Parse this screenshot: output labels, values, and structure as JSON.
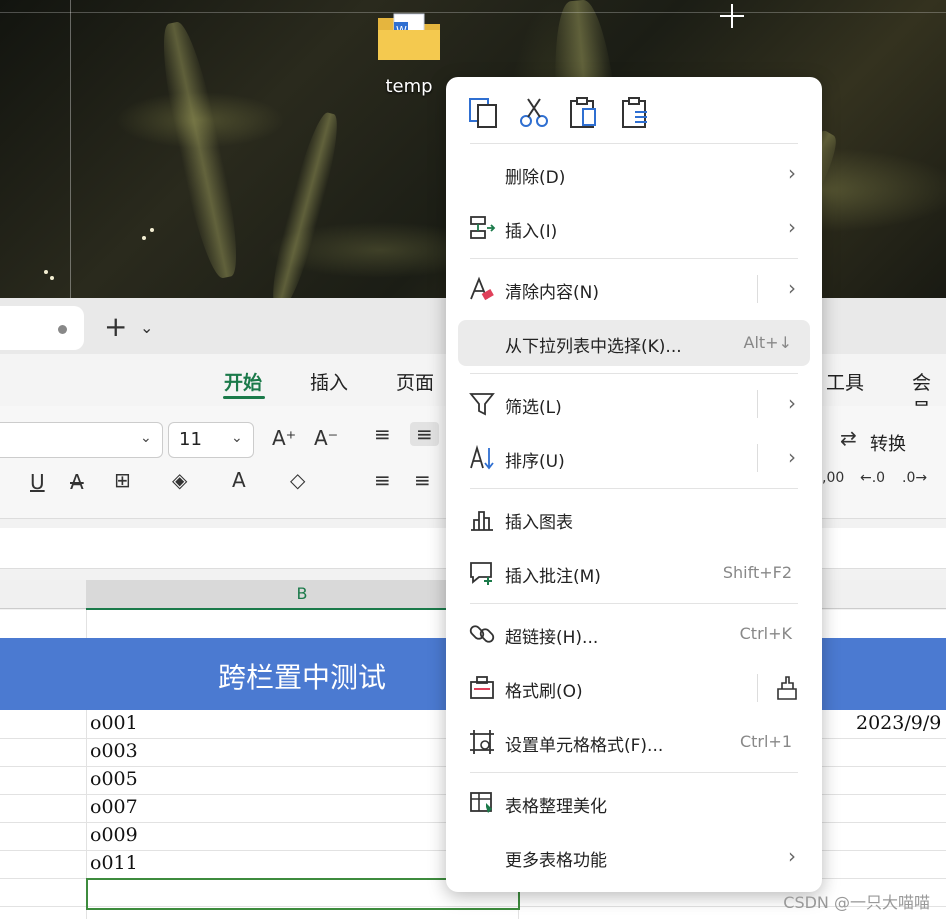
{
  "desktop": {
    "folder_label": "temp"
  },
  "app": {
    "new_tab_label": "+",
    "ribbon_tabs": [
      "开始",
      "插入",
      "页面",
      "工具",
      "会员"
    ],
    "font_size": "11",
    "convert_label": "转换",
    "column_header": "B",
    "merged_title": "跨栏置中测试",
    "cells_b": [
      "o001",
      "o003",
      "o005",
      "o007",
      "o009",
      "o011"
    ],
    "date_value": "2023/9/9"
  },
  "context_menu": {
    "quick_actions": [
      "copy-icon",
      "cut-icon",
      "paste-icon",
      "paste-special-icon"
    ],
    "items": [
      {
        "label": "删除(D)",
        "shortcut": "",
        "submenu": true
      },
      {
        "label": "插入(I)",
        "shortcut": "",
        "submenu": true
      },
      {
        "label": "清除内容(N)",
        "shortcut": "",
        "submenu": true
      },
      {
        "label": "从下拉列表中选择(K)...",
        "shortcut": "Alt+↓",
        "submenu": false
      },
      {
        "label": "筛选(L)",
        "shortcut": "",
        "submenu": true
      },
      {
        "label": "排序(U)",
        "shortcut": "",
        "submenu": true
      },
      {
        "label": "插入图表",
        "shortcut": "",
        "submenu": false
      },
      {
        "label": "插入批注(M)",
        "shortcut": "Shift+F2",
        "submenu": false
      },
      {
        "label": "超链接(H)...",
        "shortcut": "Ctrl+K",
        "submenu": false
      },
      {
        "label": "格式刷(O)",
        "shortcut": "",
        "submenu": false
      },
      {
        "label": "设置单元格格式(F)...",
        "shortcut": "Ctrl+1",
        "submenu": false
      },
      {
        "label": "表格整理美化",
        "shortcut": "",
        "submenu": false
      },
      {
        "label": "更多表格功能",
        "shortcut": "",
        "submenu": true
      }
    ]
  },
  "watermark": "CSDN @一只大喵喵",
  "colors": {
    "accent_green": "#1b7a4a",
    "header_blue": "#4b7ad1",
    "icon_blue": "#2f6fd1"
  }
}
